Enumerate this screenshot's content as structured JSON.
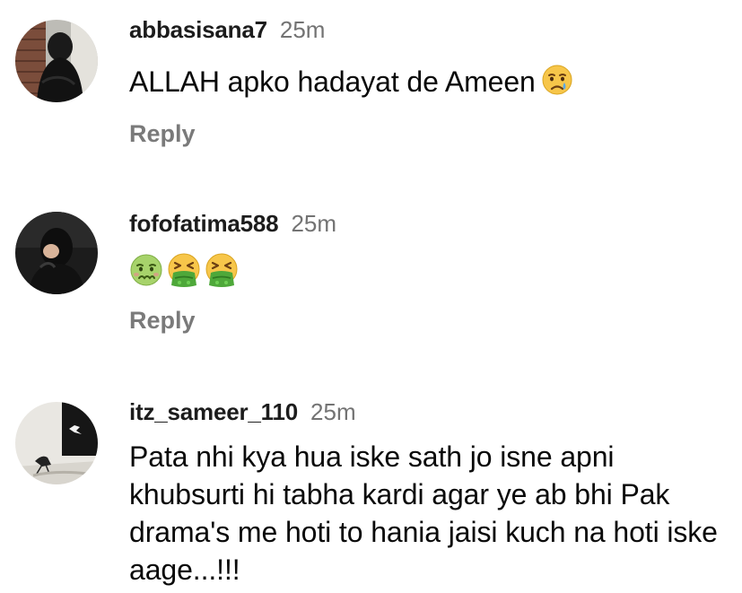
{
  "comments": [
    {
      "username": "abbasisana7",
      "time": "25m",
      "text": "ALLAH apko hadayat de Ameen",
      "emoji_icons": [
        "crying-face-icon"
      ],
      "reply_label": "Reply"
    },
    {
      "username": "fofofatima588",
      "time": "25m",
      "text": "",
      "emoji_icons": [
        "nauseated-face-icon",
        "vomiting-face-icon",
        "vomiting-face-icon"
      ],
      "reply_label": "Reply"
    },
    {
      "username": "itz_sameer_110",
      "time": "25m",
      "text": "Pata nhi kya hua iske sath jo isne apni khubsurti hi tabha kardi agar ye ab bhi Pak drama's me hoti to hania jaisi kuch na hoti iske aage...!!!",
      "emoji_icons": [],
      "reply_label": "Reply"
    }
  ],
  "colors": {
    "username": "#1c1c1c",
    "time": "#737373",
    "reply": "#7a7a7a",
    "text": "#0a0a0a"
  }
}
